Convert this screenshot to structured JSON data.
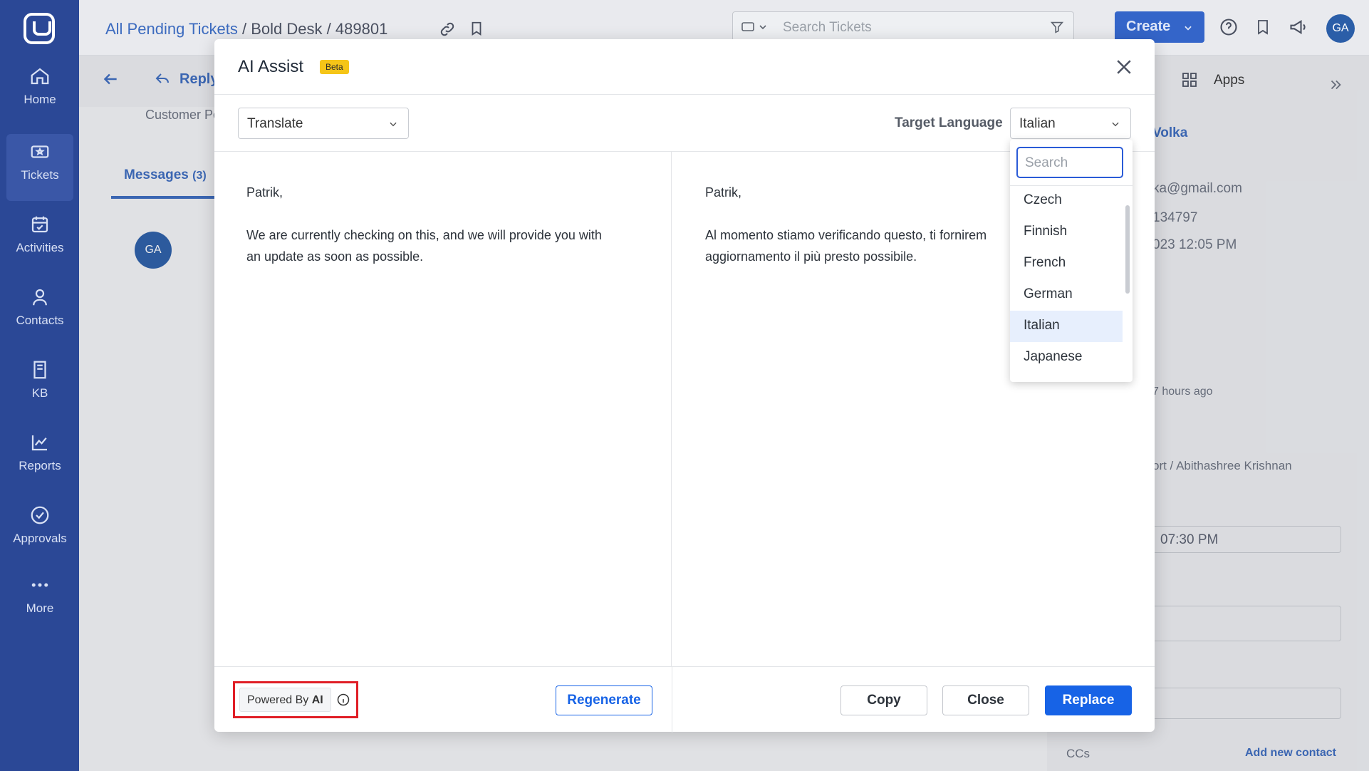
{
  "sidebar": {
    "items": [
      {
        "label": "Home",
        "icon": "home-icon"
      },
      {
        "label": "Tickets",
        "icon": "ticket-icon",
        "active": true
      },
      {
        "label": "Activities",
        "icon": "calendar-icon"
      },
      {
        "label": "Contacts",
        "icon": "person-icon"
      },
      {
        "label": "KB",
        "icon": "book-icon"
      },
      {
        "label": "Reports",
        "icon": "chart-icon"
      },
      {
        "label": "Approvals",
        "icon": "check-circle-icon"
      },
      {
        "label": "More",
        "icon": "more-dots-icon"
      }
    ]
  },
  "header": {
    "breadcrumb": [
      "All Pending Tickets",
      "Bold Desk",
      "489801"
    ],
    "separator": "/",
    "search_placeholder": "Search Tickets",
    "create_label": "Create",
    "avatar_initials": "GA"
  },
  "background": {
    "reply_label": "Reply",
    "apps_label": "Apps",
    "customer_portal": "Customer Po",
    "messages_label": "Messages",
    "messages_count": "(3)",
    "contact_name_fragment": "Volka",
    "email_fragment": "ka@gmail.com",
    "phone_fragment": "134797",
    "date_fragment": "023 12:05 PM",
    "time_ago": "7 hours ago",
    "assignee_fragment": "ort / Abithashree Krishnan",
    "due_fragment": "07:30 PM",
    "ccs_label": "CCs",
    "add_contact_label": "Add new contact",
    "msg_avatar": "GA"
  },
  "modal": {
    "title": "AI Assist",
    "beta_label": "Beta",
    "action_select": "Translate",
    "target_language_label": "Target Language",
    "target_language_value": "Italian",
    "source_text": "Patrik,\n\nWe are currently checking on this, and we will provide you with\nan update as soon as possible.",
    "translated_text": "Patrik,\n\nAl momento stiamo verificando questo, ti fornirem\naggiornamento il più presto possibile.",
    "powered_by": "Powered By",
    "powered_ai": "AI",
    "regenerate_label": "Regenerate",
    "copy_label": "Copy",
    "close_label": "Close",
    "replace_label": "Replace"
  },
  "language_dropdown": {
    "search_placeholder": "Search",
    "options": [
      "Czech",
      "Finnish",
      "French",
      "German",
      "Italian",
      "Japanese"
    ],
    "selected": "Italian"
  },
  "colors": {
    "sidebar": "#2b4896",
    "primary": "#1763e6",
    "beta_badge": "#f5c518",
    "highlight_border": "#e01e26"
  }
}
